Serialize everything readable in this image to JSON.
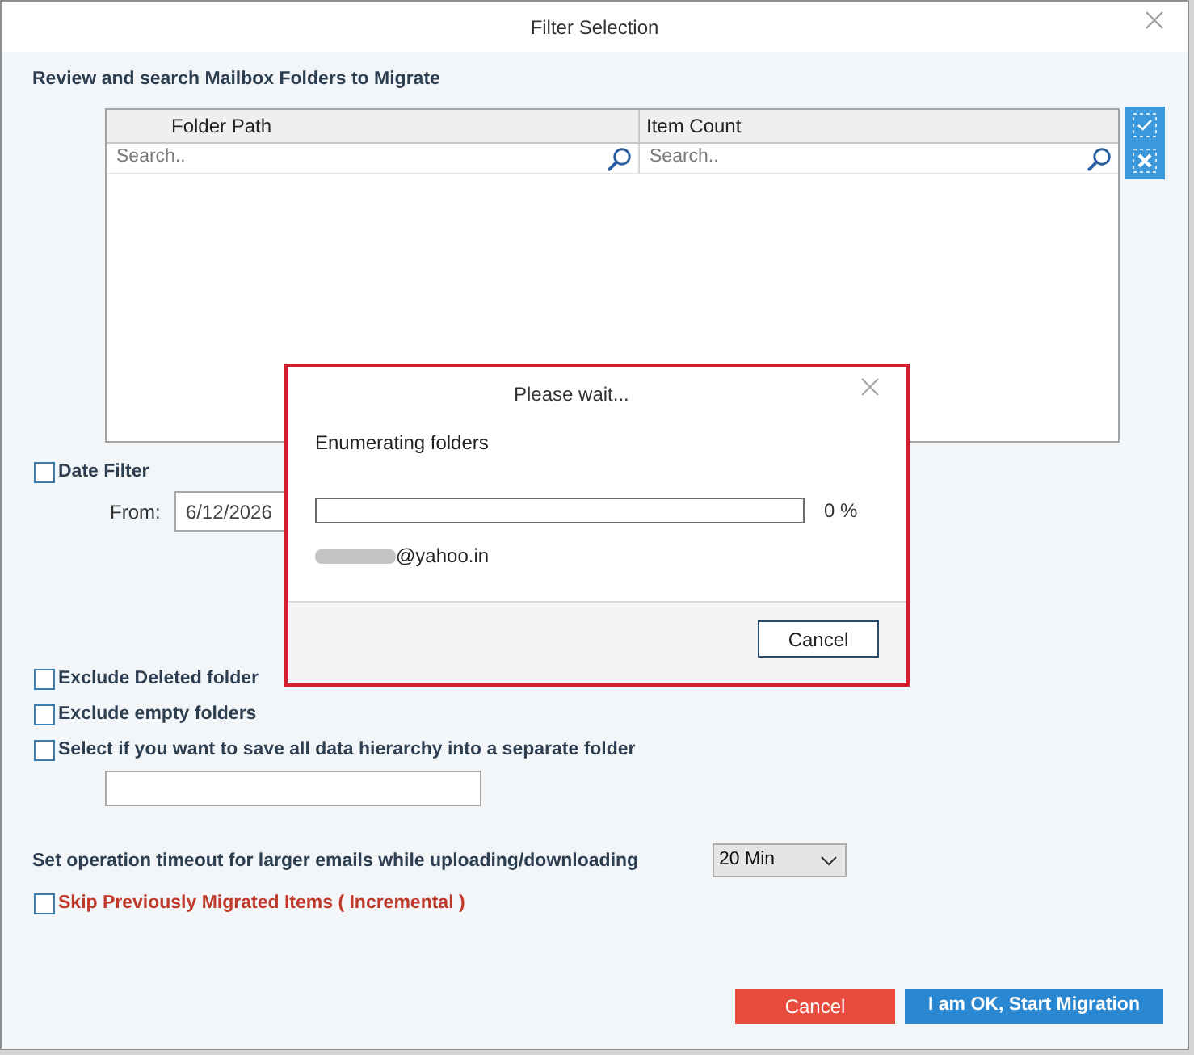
{
  "window": {
    "title": "Filter Selection"
  },
  "folders": {
    "heading": "Review and search Mailbox Folders to Migrate",
    "columns": [
      {
        "label": "Folder Path",
        "placeholder": "Search.."
      },
      {
        "label": "Item Count",
        "placeholder": "Search.."
      }
    ]
  },
  "date_filter": {
    "label": "Date Filter",
    "checked": false,
    "from_label": "From:",
    "from_value": "6/12/2026"
  },
  "options": [
    {
      "kind": "checkbox",
      "label": "Exclude Deleted folder",
      "checked": false
    },
    {
      "kind": "checkbox",
      "label": "Exclude empty folders",
      "checked": false
    },
    {
      "kind": "checkbox_with_field",
      "label": "Select if you want to save all data hierarchy into a separate folder",
      "checked": false
    }
  ],
  "timeout": {
    "label": "Set operation timeout for larger emails while uploading/downloading",
    "value": "20 Min"
  },
  "incremental": {
    "label": "Skip Previously Migrated Items ( Incremental )",
    "checked": false
  },
  "buttons": [
    {
      "kind": "cancel",
      "label": "Cancel"
    },
    {
      "kind": "primary",
      "label": "I am OK, Start Migration"
    }
  ],
  "progress_dialog": {
    "title": "Please wait...",
    "message": "Enumerating folders",
    "level": 0,
    "reading": "0 %",
    "account": "@yahoo.in",
    "buttons": [
      {
        "label": "Cancel"
      }
    ]
  }
}
